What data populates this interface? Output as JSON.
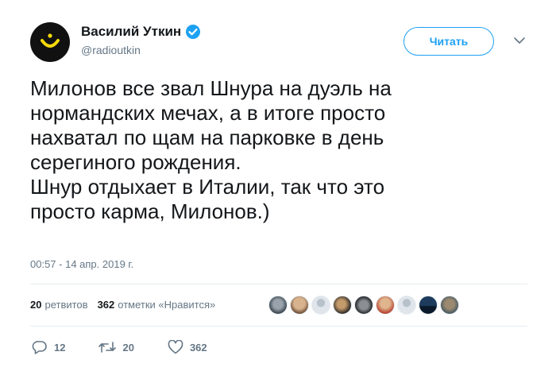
{
  "author": {
    "name": "Василий Уткин",
    "handle": "@radioutkin"
  },
  "follow_label": "Читать",
  "tweet": {
    "lines": [
      "Милонов все звал Шнура на дуэль на",
      "нормандских мечах, а в итоге просто",
      "нахватал по щам на парковке в день",
      "серегиного рождения.",
      "Шнур отдыхает в Италии, так что это",
      "просто карма, Милонов.)"
    ],
    "timestamp": "00:57 - 14 апр. 2019 г."
  },
  "stats": {
    "retweets_count": "20",
    "retweets_label": "ретвитов",
    "likes_count": "362",
    "likes_label": "отметки «Нравится»"
  },
  "actions": {
    "reply_count": "12",
    "retweet_count": "20",
    "like_count": "362"
  },
  "colors": {
    "accent": "#1da1f2",
    "secondary_text": "#657786",
    "avatar_bg": "#111111",
    "avatar_logo": "#f5d90a"
  },
  "icons": [
    "logo-smile-icon",
    "verified-badge-icon",
    "chevron-down-icon",
    "reply-icon",
    "retweet-icon",
    "like-icon"
  ]
}
